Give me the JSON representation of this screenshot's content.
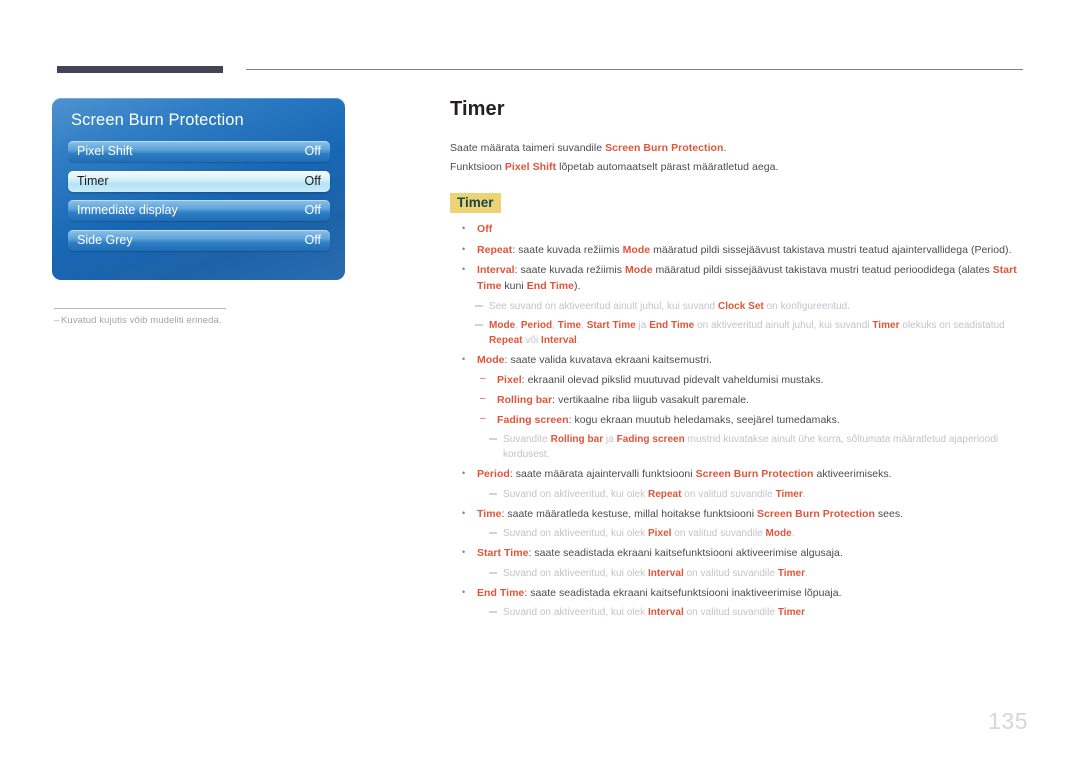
{
  "header": {
    "bar_color": "#434257",
    "rule_color": "#808080"
  },
  "osd_panel": {
    "title": "Screen Burn Protection",
    "rows": [
      {
        "label": "Pixel Shift",
        "value": "Off",
        "selected": false
      },
      {
        "label": "Timer",
        "value": "Off",
        "selected": true
      },
      {
        "label": "Immediate display",
        "value": "Off",
        "selected": false
      },
      {
        "label": "Side Grey",
        "value": "Off",
        "selected": false
      }
    ],
    "footnote": "Kuvatud kujutis võib mudeliti erineda."
  },
  "main": {
    "title": "Timer",
    "intro_1_a": "Saate määrata taimeri suvandile ",
    "intro_1_b": "Screen Burn Protection",
    "intro_1_c": ".",
    "intro_2_a": "Funktsioon ",
    "intro_2_b": "Pixel Shift",
    "intro_2_c": " lõpetab automaatselt pärast määratletud aega.",
    "section_heading": "Timer",
    "items": {
      "off": "Off",
      "repeat_key": "Repeat",
      "repeat_txt_a": ": saate kuvada režiimis ",
      "repeat_mode": "Mode",
      "repeat_txt_b": " määratud pildi sissejäävust takistava mustri teatud ajaintervallidega (Period).",
      "interval_key": "Interval",
      "interval_txt_a": ": saate kuvada režiimis ",
      "interval_mode": "Mode",
      "interval_txt_b": " määratud pildi sissejäävust takistava mustri teatud perioodidega (alates ",
      "interval_start": "Start Time",
      "interval_txt_c": " kuni ",
      "interval_end": "End Time",
      "interval_txt_d": ").",
      "note_clock_a": "See suvand on aktiveeritud ainult juhul, kui suvand ",
      "note_clock_key": "Clock Set",
      "note_clock_b": " on konfigureeritud.",
      "note_modes_k1": "Mode",
      "note_modes_s1": ", ",
      "note_modes_k2": "Period",
      "note_modes_s2": ", ",
      "note_modes_k3": "Time",
      "note_modes_s3": ", ",
      "note_modes_k4": "Start Time",
      "note_modes_s4": " ja ",
      "note_modes_k5": "End Time",
      "note_modes_b": " on aktiveeritud ainult juhul, kui suvandi ",
      "note_modes_k6": "Timer",
      "note_modes_c": " olekuks on seadistatud ",
      "note_modes_k7": "Repeat",
      "note_modes_d": " või ",
      "note_modes_k8": "Interval",
      "note_modes_e": ".",
      "mode_key": "Mode",
      "mode_txt": ": saate valida kuvatava ekraani kaitsemustri.",
      "pixel_key": "Pixel",
      "pixel_txt": ": ekraanil olevad pikslid muutuvad pidevalt vaheldumisi mustaks.",
      "rolling_key": "Rolling bar",
      "rolling_txt": ": vertikaalne riba liigub vasakult paremale.",
      "fading_key": "Fading screen",
      "fading_txt": ": kogu ekraan muutub heledamaks, seejärel tumedamaks.",
      "note_patterns_a": "Suvandite ",
      "note_patterns_k1": "Rolling bar",
      "note_patterns_b": " ja ",
      "note_patterns_k2": "Fading screen",
      "note_patterns_c": " mustrid kuvatakse ainult ühe korra, sõltumata määratletud ajaperioodi kordusest.",
      "period_key": "Period",
      "period_txt_a": ": saate määrata ajaintervalli funktsiooni ",
      "period_sbp": "Screen Burn Protection",
      "period_txt_b": " aktiveerimiseks.",
      "note_period_a": "Suvand on aktiveeritud, kui olek ",
      "note_period_k1": "Repeat",
      "note_period_b": " on valitud suvandile ",
      "note_period_k2": "Timer",
      "note_period_c": ".",
      "time_key": "Time",
      "time_txt_a": ": saate määratleda kestuse, millal hoitakse funktsiooni ",
      "time_sbp": "Screen Burn Protection",
      "time_txt_b": " sees.",
      "note_time_a": "Suvand on aktiveeritud, kui olek ",
      "note_time_k1": "Pixel",
      "note_time_b": " on valitud suvandile ",
      "note_time_k2": "Mode",
      "note_time_c": ".",
      "start_key": "Start Time",
      "start_txt": ": saate seadistada ekraani kaitsefunktsiooni aktiveerimise algusaja.",
      "note_start_a": "Suvand on aktiveeritud, kui olek ",
      "note_start_k1": "Interval",
      "note_start_b": " on valitud suvandile ",
      "note_start_k2": "Timer",
      "note_start_c": ".",
      "end_key": "End Time",
      "end_txt": ": saate seadistada ekraani kaitsefunktsiooni inaktiveerimise lõpuaja.",
      "note_end_a": "Suvand on aktiveeritud, kui olek ",
      "note_end_k1": "Interval",
      "note_end_b": " on valitud suvandile ",
      "note_end_k2": "Timer",
      "note_end_c": "."
    }
  },
  "folio": "135",
  "colors": {
    "accent_red": "#e1543a",
    "highlight_yellow": "#ecd375",
    "highlight_text": "#18484f",
    "body_text": "#4b4b50",
    "note_gray": "#c3c3ca",
    "osd_blue": "#1766b4"
  }
}
